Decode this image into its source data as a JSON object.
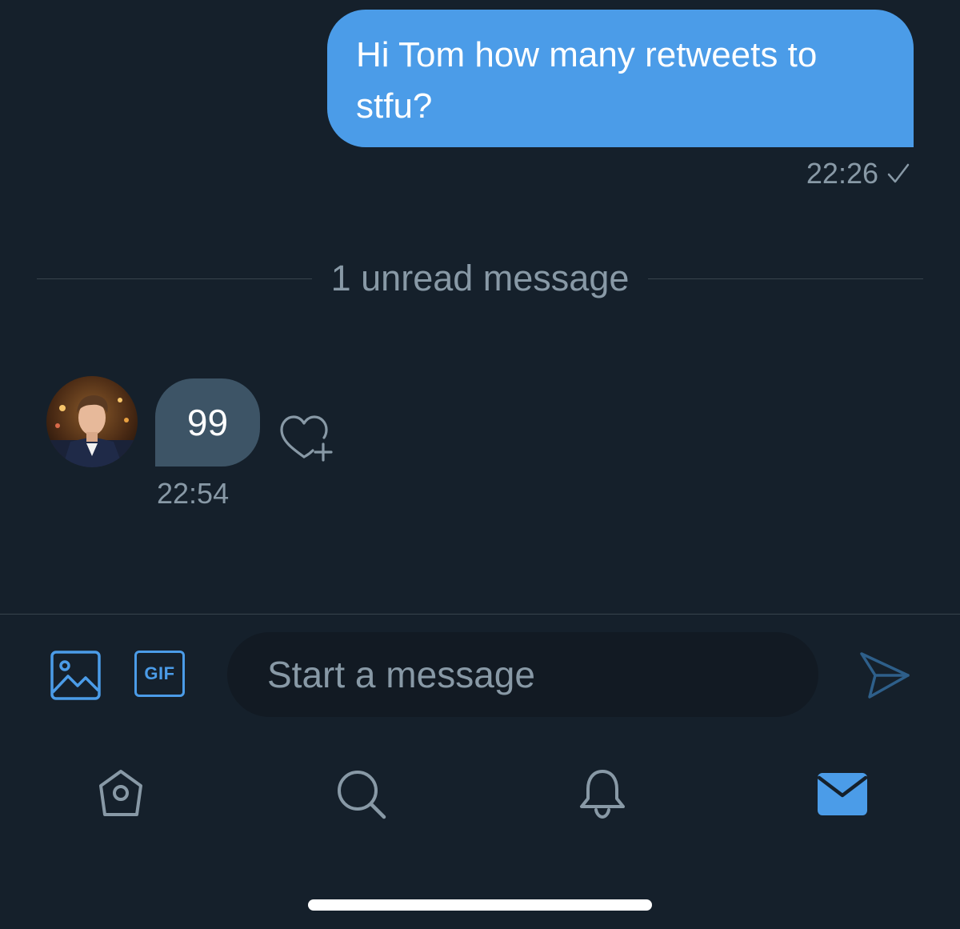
{
  "conversation": {
    "sent_message": {
      "text": "Hi Tom how many retweets to stfu?",
      "time": "22:26",
      "status_icon": "check-icon"
    },
    "unread_divider": "1 unread message",
    "received_message": {
      "text": "99",
      "time": "22:54",
      "reaction_icon": "heart-add-icon"
    }
  },
  "composer": {
    "media_icon": "image-icon",
    "gif_label": "GIF",
    "placeholder": "Start a message",
    "value": "",
    "send_icon": "send-icon"
  },
  "bottom_nav": {
    "items": [
      {
        "name": "home",
        "icon": "home-icon",
        "active": false
      },
      {
        "name": "search",
        "icon": "search-icon",
        "active": false
      },
      {
        "name": "notifications",
        "icon": "bell-icon",
        "active": false
      },
      {
        "name": "messages",
        "icon": "mail-icon",
        "active": true
      }
    ]
  },
  "colors": {
    "background": "#15202b",
    "accent": "#4b9ce8",
    "received_bubble": "#3d5466",
    "muted_text": "#8899a6",
    "input_background": "#121a23",
    "divider": "#38444d"
  }
}
